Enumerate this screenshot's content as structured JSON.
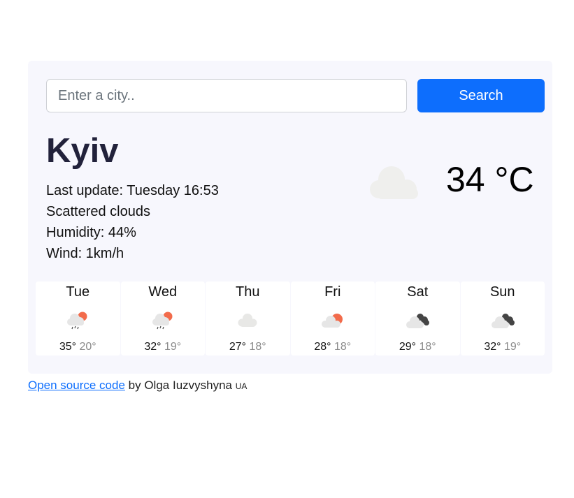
{
  "search": {
    "placeholder": "Enter a city..",
    "button_label": "Search"
  },
  "current": {
    "city": "Kyiv",
    "last_update": "Last update: Tuesday 16:53",
    "description": "Scattered clouds",
    "humidity": "Humidity: 44%",
    "wind": "Wind: 1km/h",
    "temperature": "34 °C",
    "icon": "scattered-clouds-icon"
  },
  "forecast": [
    {
      "day": "Tue",
      "max": "35°",
      "min": "20°",
      "icon": "rain-sun-icon"
    },
    {
      "day": "Wed",
      "max": "32°",
      "min": "19°",
      "icon": "rain-sun-icon"
    },
    {
      "day": "Thu",
      "max": "27°",
      "min": "18°",
      "icon": "cloud-icon"
    },
    {
      "day": "Fri",
      "max": "28°",
      "min": "18°",
      "icon": "cloud-sun-icon"
    },
    {
      "day": "Sat",
      "max": "29°",
      "min": "18°",
      "icon": "broken-clouds-icon"
    },
    {
      "day": "Sun",
      "max": "32°",
      "min": "19°",
      "icon": "broken-clouds-icon"
    }
  ],
  "footer": {
    "link_text": "Open source code",
    "by_text": "by Olga Iuzvyshyna",
    "flag": "UA"
  },
  "colors": {
    "accent": "#0d6efd",
    "card_background": "#f7f7fd",
    "city": "#22223b",
    "sun": "#f26b4b"
  }
}
